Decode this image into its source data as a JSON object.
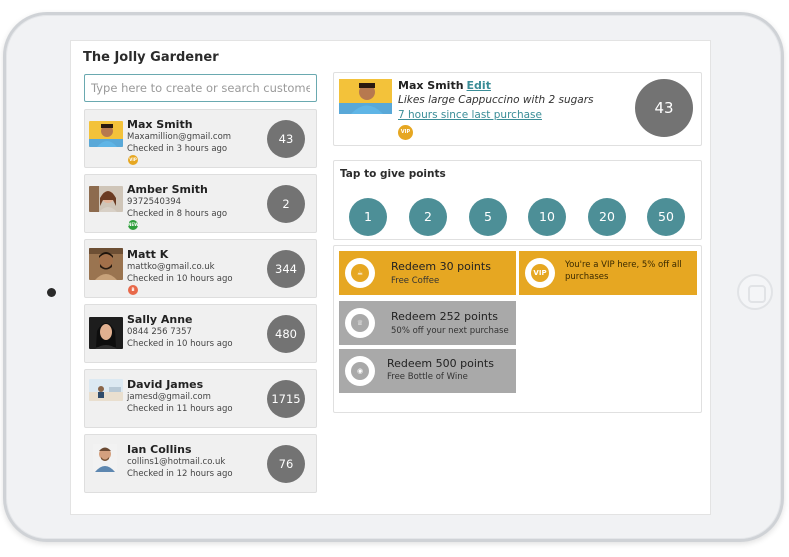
{
  "app": {
    "title": "The Jolly Gardener"
  },
  "search": {
    "placeholder": "Type here to create or search customer"
  },
  "customers": [
    {
      "name": "Max Smith",
      "contact": "Maxamillion@gmail.com",
      "checked_in": "Checked in 3 hours ago",
      "points": "43",
      "badge": "VIP",
      "badge_color": "#e6a722"
    },
    {
      "name": "Amber Smith",
      "contact": "9372540394",
      "checked_in": "Checked in 8 hours ago",
      "points": "2",
      "badge": "NEW",
      "badge_color": "#2e9e3b"
    },
    {
      "name": "Matt K",
      "contact": "mattko@gmail.co.uk",
      "checked_in": "Checked in 10 hours ago",
      "points": "344",
      "badge": "B",
      "badge_color": "#e8694a"
    },
    {
      "name": "Sally Anne",
      "contact": "0844 256 7357",
      "checked_in": "Checked in 10 hours ago",
      "points": "480",
      "badge": "",
      "badge_color": ""
    },
    {
      "name": "David James",
      "contact": "jamesd@gmail.com",
      "checked_in": "Checked in 11 hours ago",
      "points": "1715",
      "badge": "",
      "badge_color": ""
    },
    {
      "name": "Ian Collins",
      "contact": "collins1@hotmail.co.uk",
      "checked_in": "Checked in 12 hours ago",
      "points": "76",
      "badge": "",
      "badge_color": ""
    }
  ],
  "profile": {
    "name": "Max Smith",
    "edit_label": "Edit",
    "note": "Likes large Cappuccino with 2 sugars",
    "last_purchase": "7 hours since last purchase",
    "badge": "VIP",
    "points": "43"
  },
  "tap": {
    "title": "Tap to give points",
    "options": [
      "1",
      "2",
      "5",
      "10",
      "20",
      "50"
    ]
  },
  "rewards": [
    {
      "title": "Redeem 30 points",
      "subtitle": "Free Coffee",
      "icon": "coffee-cup-icon",
      "style": "gold"
    },
    {
      "title": "",
      "subtitle": "You're a VIP here, 5% off all purchases",
      "icon": "vip-icon",
      "style": "gold"
    },
    {
      "title": "Redeem 252 points",
      "subtitle": "50% off your next purchase",
      "icon": "trophy-icon",
      "style": "grey"
    },
    {
      "title": "Redeem 500 points",
      "subtitle": "Free Bottle of Wine",
      "icon": "wine-glass-icon",
      "style": "grey"
    }
  ],
  "colors": {
    "teal": "#4d8f97",
    "gold": "#e6a722",
    "grey_tile": "#a9a9a9",
    "points_circle": "#737373"
  }
}
